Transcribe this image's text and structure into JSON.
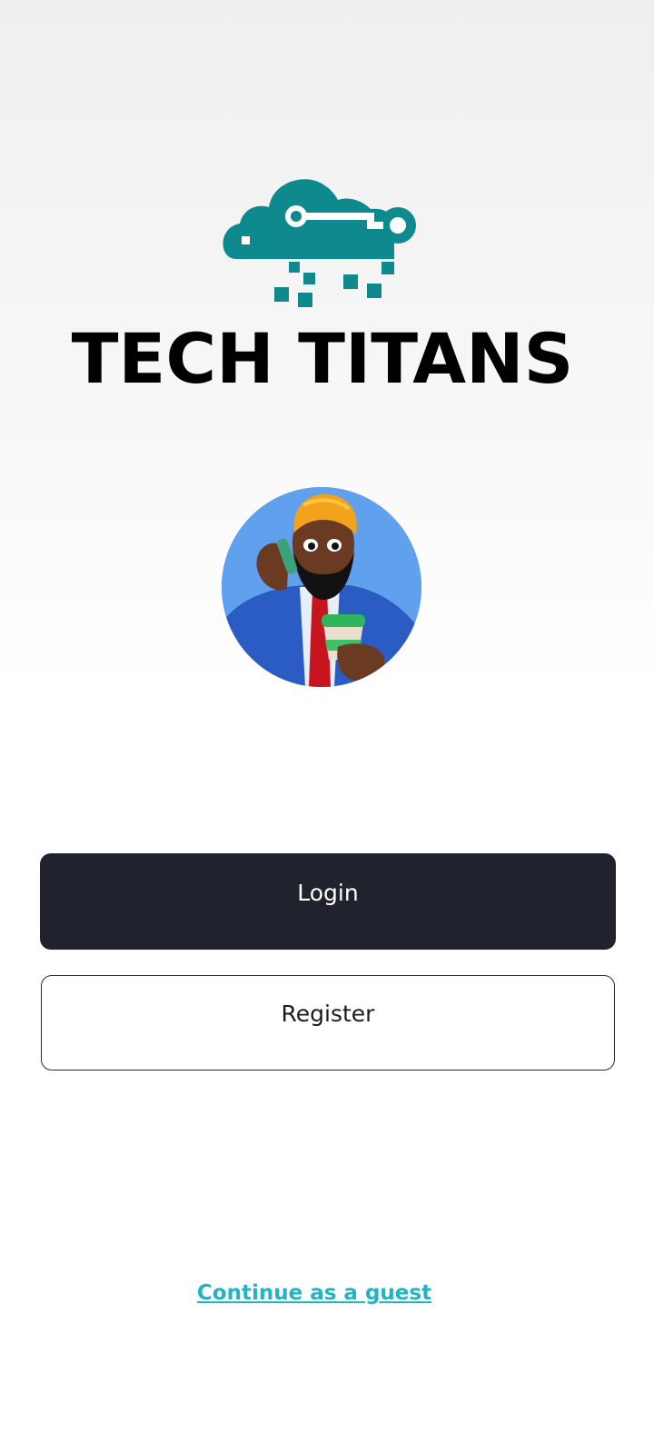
{
  "brand": {
    "name": "TECH TITANS",
    "logo_icon": "cloud-circuit-logo",
    "logo_color": "#0e8a8e"
  },
  "avatar": {
    "icon": "avatar-illustration"
  },
  "actions": {
    "login_label": "Login",
    "register_label": "Register",
    "guest_label": "Continue as a guest"
  },
  "colors": {
    "primary_dark": "#20222e",
    "link": "#1fb5c4"
  }
}
